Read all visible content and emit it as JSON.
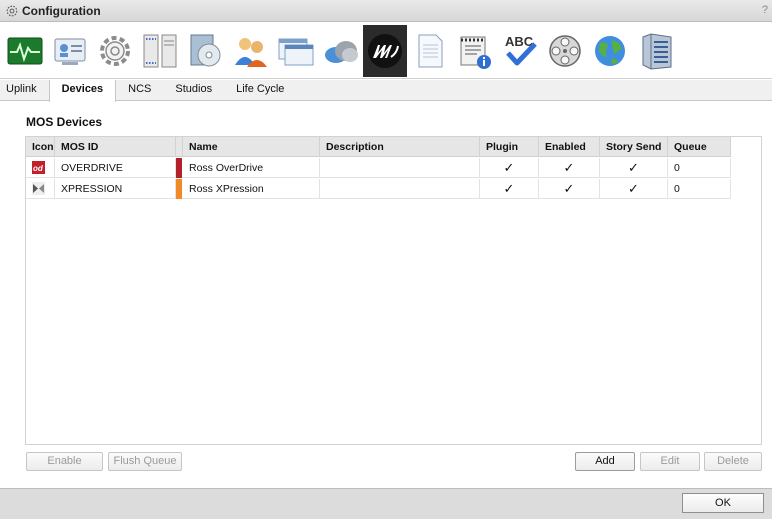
{
  "window": {
    "title": "Configuration",
    "help_label": "?"
  },
  "toolbar": {
    "icons": [
      "monitor-icon",
      "id-card-icon",
      "gear-icon",
      "server-icon",
      "disc-icon",
      "users-icon",
      "window-icon",
      "cloud-icon",
      "ross-logo-icon",
      "document-icon",
      "notepad-info-icon",
      "spellcheck-icon",
      "film-reel-icon",
      "globe-icon",
      "storage-icon"
    ],
    "active_index": 8
  },
  "tabs": [
    {
      "label": "Uplink",
      "active": false
    },
    {
      "label": "Devices",
      "active": true
    },
    {
      "label": "NCS",
      "active": false
    },
    {
      "label": "Studios",
      "active": false
    },
    {
      "label": "Life Cycle",
      "active": false
    }
  ],
  "section": {
    "title": "MOS Devices"
  },
  "table": {
    "headers": {
      "icon": "Icon",
      "mos_id": "MOS ID",
      "name": "Name",
      "description": "Description",
      "plugin": "Plugin",
      "enabled": "Enabled",
      "story_send": "Story Send",
      "queue": "Queue"
    },
    "rows": [
      {
        "icon": "overdrive-icon",
        "mos_id": "OVERDRIVE",
        "color": "#b3202a",
        "name": "Ross OverDrive",
        "description": "",
        "plugin": "✓",
        "enabled": "✓",
        "story_send": "✓",
        "queue": "0"
      },
      {
        "icon": "xpression-icon",
        "mos_id": "XPRESSION",
        "color": "#ef8a26",
        "name": "Ross XPression",
        "description": "",
        "plugin": "✓",
        "enabled": "✓",
        "story_send": "✓",
        "queue": "0"
      }
    ]
  },
  "buttons": {
    "enable": "Enable",
    "flush_queue": "Flush Queue",
    "add": "Add",
    "edit": "Edit",
    "delete": "Delete",
    "ok": "OK"
  }
}
